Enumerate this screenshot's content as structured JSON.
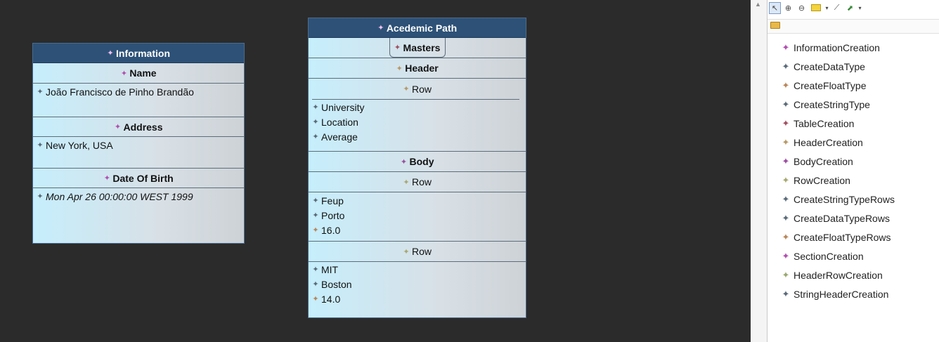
{
  "information_node": {
    "title": "Information",
    "name_label": "Name",
    "name_value": "João Francisco de Pinho Brandão",
    "address_label": "Address",
    "address_value": "New York, USA",
    "dob_label": "Date Of Birth",
    "dob_value": "Mon Apr 26 00:00:00 WEST 1999"
  },
  "academic_node": {
    "title": "Acedemic Path",
    "masters": "Masters",
    "header": "Header",
    "header_row": "Row",
    "header_items": [
      "University",
      "Location",
      "Average"
    ],
    "body": "Body",
    "rows": [
      {
        "label": "Row",
        "items": [
          "Feup",
          "Porto",
          "16.0"
        ]
      },
      {
        "label": "Row",
        "items": [
          "MIT",
          "Boston",
          "14.0"
        ]
      }
    ]
  },
  "palette": {
    "items": [
      {
        "label": "InformationCreation",
        "color": "#b04fb0"
      },
      {
        "label": "CreateDataType",
        "color": "#5a6a78"
      },
      {
        "label": "CreateFloatType",
        "color": "#b8865a"
      },
      {
        "label": "CreateStringType",
        "color": "#5a6a78"
      },
      {
        "label": "TableCreation",
        "color": "#a05060"
      },
      {
        "label": "HeaderCreation",
        "color": "#b89866"
      },
      {
        "label": "BodyCreation",
        "color": "#9a4fa0"
      },
      {
        "label": "RowCreation",
        "color": "#a8a870"
      },
      {
        "label": "CreateStringTypeRows",
        "color": "#5a6a78"
      },
      {
        "label": "CreateDataTypeRows",
        "color": "#5a6a78"
      },
      {
        "label": "CreateFloatTypeRows",
        "color": "#b8865a"
      },
      {
        "label": "SectionCreation",
        "color": "#b04fb0"
      },
      {
        "label": "HeaderRowCreation",
        "color": "#9aa870"
      },
      {
        "label": "StringHeaderCreation",
        "color": "#5a6a78"
      }
    ]
  }
}
